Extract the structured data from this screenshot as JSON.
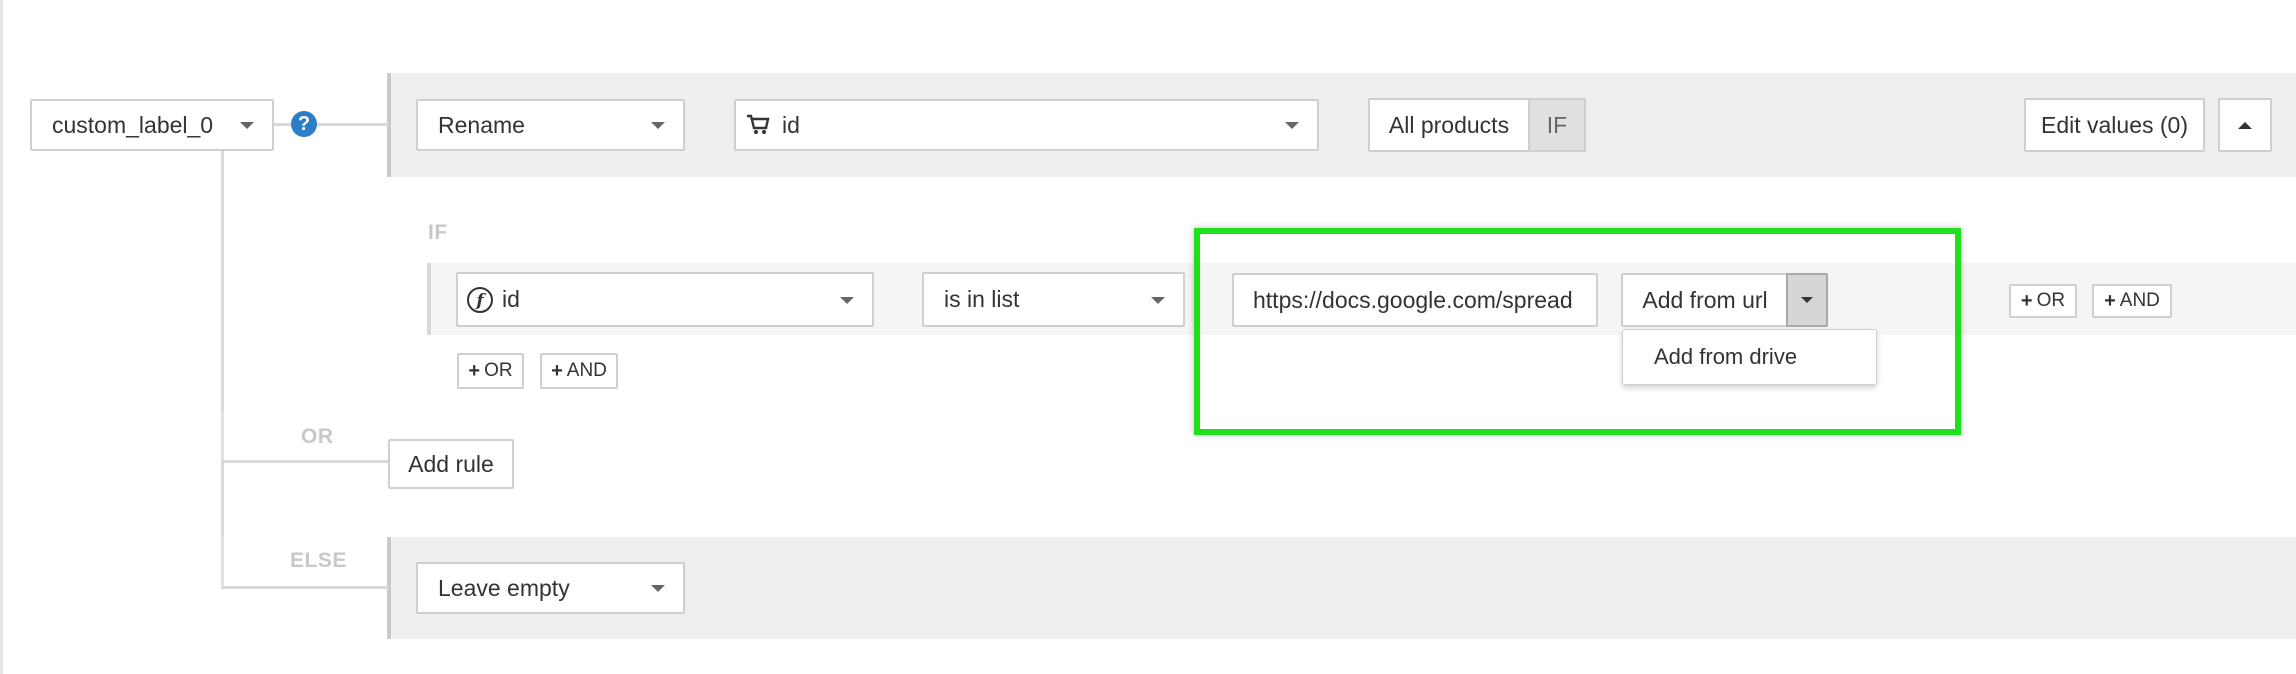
{
  "field_select": {
    "value": "custom_label_0"
  },
  "action_row": {
    "action": "Rename",
    "source_field": "id",
    "all_products": "All products",
    "if_toggle": "IF",
    "edit_values": "Edit values (0)"
  },
  "condition": {
    "label": "IF",
    "field": "id",
    "operator": "is in list",
    "url_value": "https://docs.google.com/spread",
    "add_from_url": "Add from url",
    "menu": {
      "add_from_drive": "Add from drive"
    },
    "or_label": "OR",
    "and_label": "AND"
  },
  "or_section": {
    "label": "OR",
    "add_rule": "Add rule"
  },
  "else_section": {
    "label": "ELSE",
    "action": "Leave empty"
  },
  "highlight_color": "#1ee01e",
  "accent_color": "#2c7ec8",
  "icons": {
    "help": "question-circle-icon",
    "field": "function-icon",
    "cart": "shopping-cart-icon",
    "caret": "caret-down-icon",
    "up": "caret-up-icon",
    "plus": "plus-icon"
  }
}
